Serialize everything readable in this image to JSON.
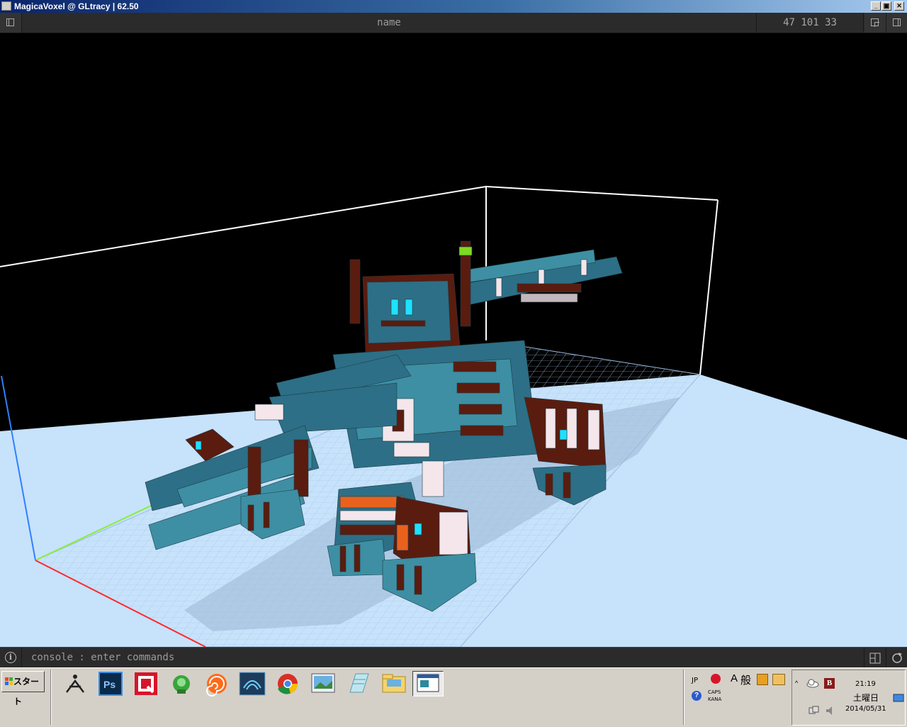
{
  "window": {
    "title": "MagicaVoxel @ GLtracy | 62.50",
    "controls": {
      "minimize": "_",
      "restore": "▣",
      "close": "✕"
    }
  },
  "toolbar": {
    "model_name": "name",
    "dimensions": "47 101 33"
  },
  "console": {
    "placeholder": "console : enter commands"
  },
  "viewport": {
    "background": "#000000",
    "ground_color": "#c7e2fb",
    "grid_color": "#a9c8e6",
    "axis_colors": {
      "x": "#ff2a2a",
      "y": "#86ee3c",
      "z": "#2f80ff"
    },
    "voxel_colors": {
      "teal": "#2d6f86",
      "teal_light": "#3e8fa3",
      "brown": "#5a1c0f",
      "white": "#f4e6ea",
      "orange": "#e8621e",
      "cyan_eye": "#1fe0ff",
      "green_tip": "#7ddc1f"
    }
  },
  "taskbar": {
    "start_label": "スタート",
    "apps": [
      "zbrush-icon",
      "photoshop-icon",
      "q-app-icon",
      "green-app-icon",
      "houdini-icon",
      "maya-icon",
      "chrome-icon",
      "image-viewer-icon",
      "notepad-icon",
      "folder-icon",
      "magicavoxel-task-icon"
    ],
    "ime": {
      "lang": "JP",
      "mode": "A",
      "mode_kanji": "般",
      "caps": "CAPS",
      "kana": "KANA"
    },
    "tray": {
      "badge": "B"
    },
    "clock": {
      "time": "21:19",
      "day": "土曜日",
      "date": "2014/05/31"
    }
  }
}
